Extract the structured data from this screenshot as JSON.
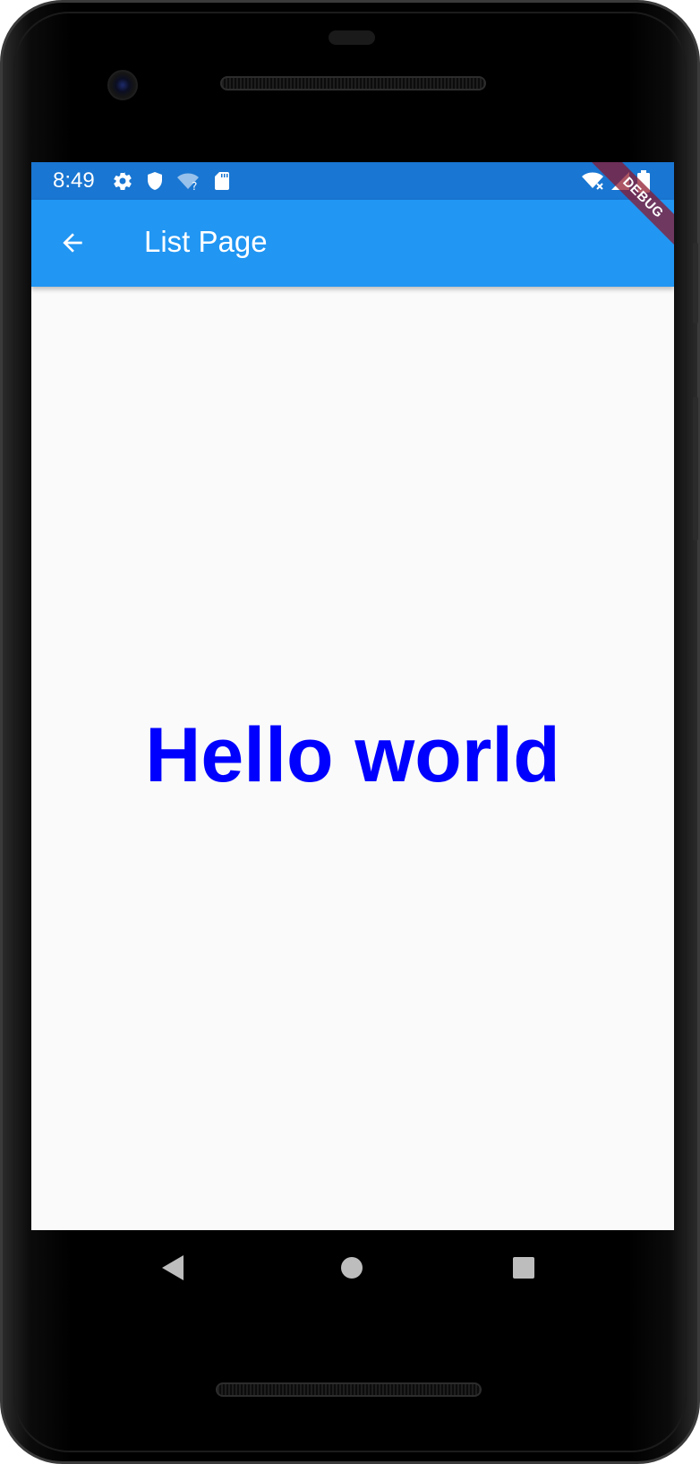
{
  "status_bar": {
    "time": "8:49",
    "color": "#1976d2",
    "icons_left": [
      "settings-gear-icon",
      "shield-icon",
      "wifi-question-icon",
      "sd-card-icon"
    ],
    "icons_right": [
      "wifi-off-icon",
      "signal-icon",
      "battery-icon"
    ]
  },
  "app_bar": {
    "title": "List Page",
    "color": "#2196f3",
    "back_icon": "arrow-back-icon"
  },
  "debug_banner": {
    "label": "DEBUG"
  },
  "body": {
    "text": "Hello world",
    "text_color": "#0000ff"
  },
  "nav_bar": {
    "buttons": [
      "back-triangle-icon",
      "home-circle-icon",
      "recents-square-icon"
    ]
  }
}
